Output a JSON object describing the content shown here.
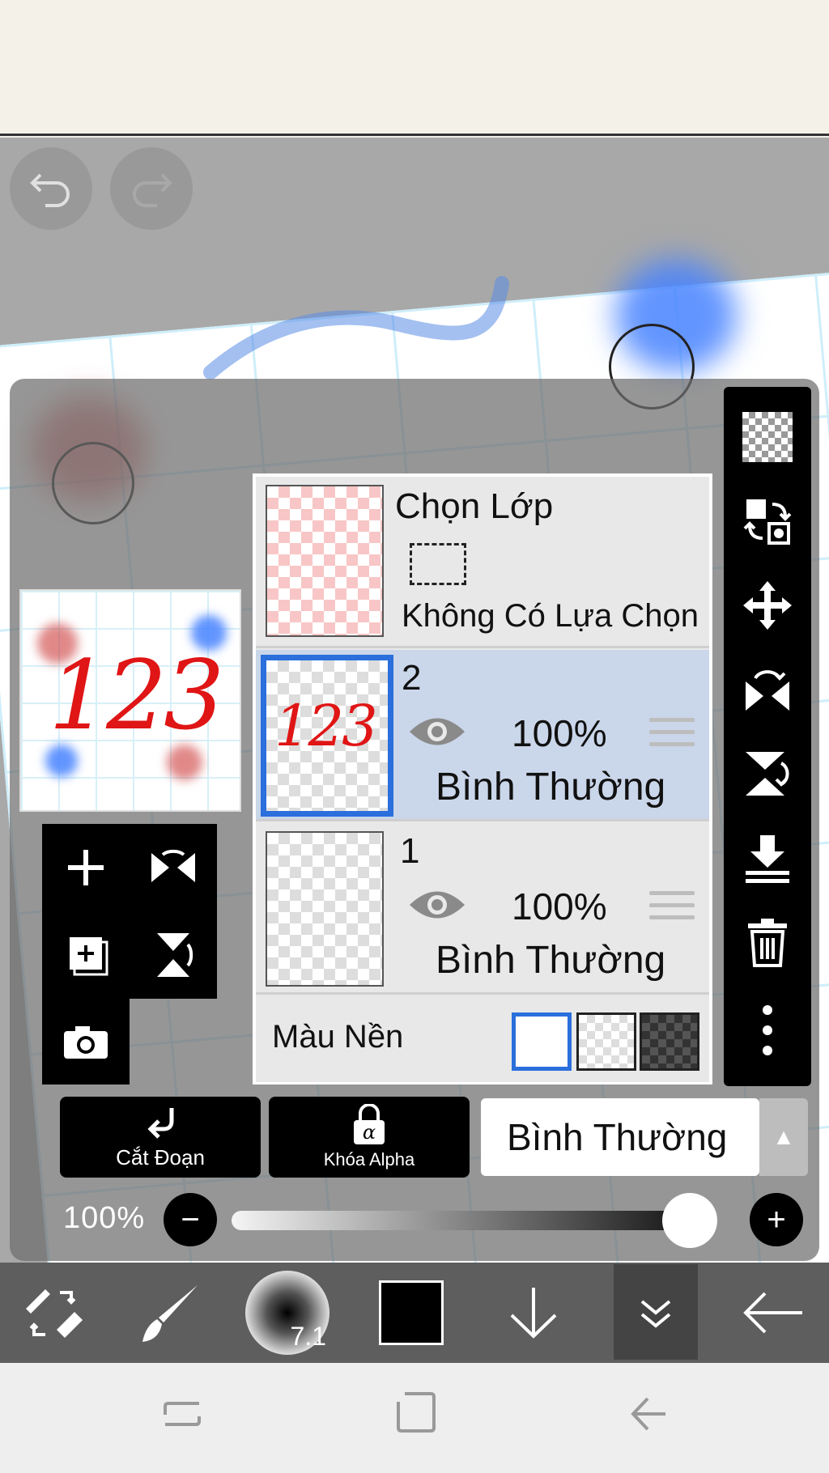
{
  "history": {
    "undo": "undo",
    "redo": "redo"
  },
  "layers_panel": {
    "selection_layer": {
      "title": "Chọn Lớp",
      "status": "Không Có Lựa Chọn"
    },
    "layers": [
      {
        "name": "2",
        "opacity": "100%",
        "blend": "Bình Thường",
        "selected": true
      },
      {
        "name": "1",
        "opacity": "100%",
        "blend": "Bình Thường",
        "selected": false
      }
    ],
    "background": {
      "label": "Màu Nền",
      "swatches": [
        "white",
        "transparent",
        "dark-checker"
      ]
    }
  },
  "preview": {
    "digits": "123"
  },
  "bottom_controls": {
    "clipping_label": "Cắt Đoạn",
    "alpha_lock_label": "Khóa Alpha",
    "blend_mode": "Bình Thường",
    "opacity_label": "100%",
    "opacity_value": 1.0
  },
  "toolbar": {
    "brush_size": "7.1",
    "color": "#000000"
  },
  "colors": {
    "accent": "#2a6fdc",
    "selected_row": "#cad6ea"
  }
}
